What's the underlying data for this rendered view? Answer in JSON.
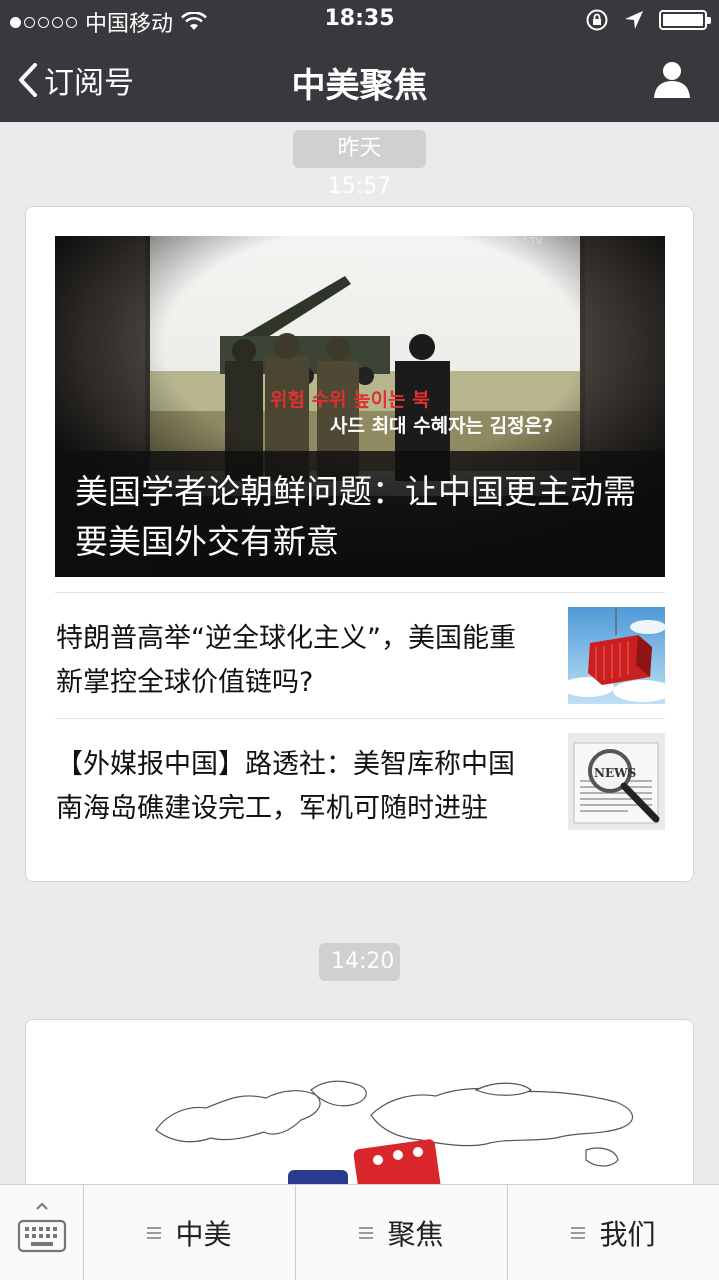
{
  "status": {
    "carrier": "中国移动",
    "time": "18:35",
    "signal_dots_filled": 1,
    "signal_dots_total": 5
  },
  "nav": {
    "back_label": "订阅号",
    "title": "中美聚焦",
    "icons": [
      "back-chevron-icon",
      "person-icon"
    ]
  },
  "messages": [
    {
      "time": "昨天 15:57",
      "hero_title": "美国学者论朝鲜问题：让中国更主动需要美国外交有新意",
      "hero_image_text": {
        "line1": "위험 수위 높이는 북",
        "line2": "사드 최대 수혜자는 김정은?",
        "watermark": "연합뉴스TV"
      },
      "items": [
        {
          "title": "特朗普高举“逆全球化主义”，美国能重新掌控全球价值链吗?",
          "thumb": "shipping-container"
        },
        {
          "title": "【外媒报中国】路透社：美智库称中国南海岛礁建设完工，军机可随时进驻",
          "thumb": "news-magnifier",
          "thumb_text": "NEWS"
        }
      ]
    },
    {
      "time": "14:20",
      "hero_image": "world-map-with-dice"
    }
  ],
  "bottom_menu": {
    "items": [
      "中美",
      "聚焦",
      "我们"
    ],
    "icons": [
      "keyboard-icon",
      "menu-lines-icon"
    ]
  },
  "colors": {
    "nav_bg": "#37393c",
    "page_bg": "#ebebeb",
    "pill_bg": "#d0d0d0"
  }
}
